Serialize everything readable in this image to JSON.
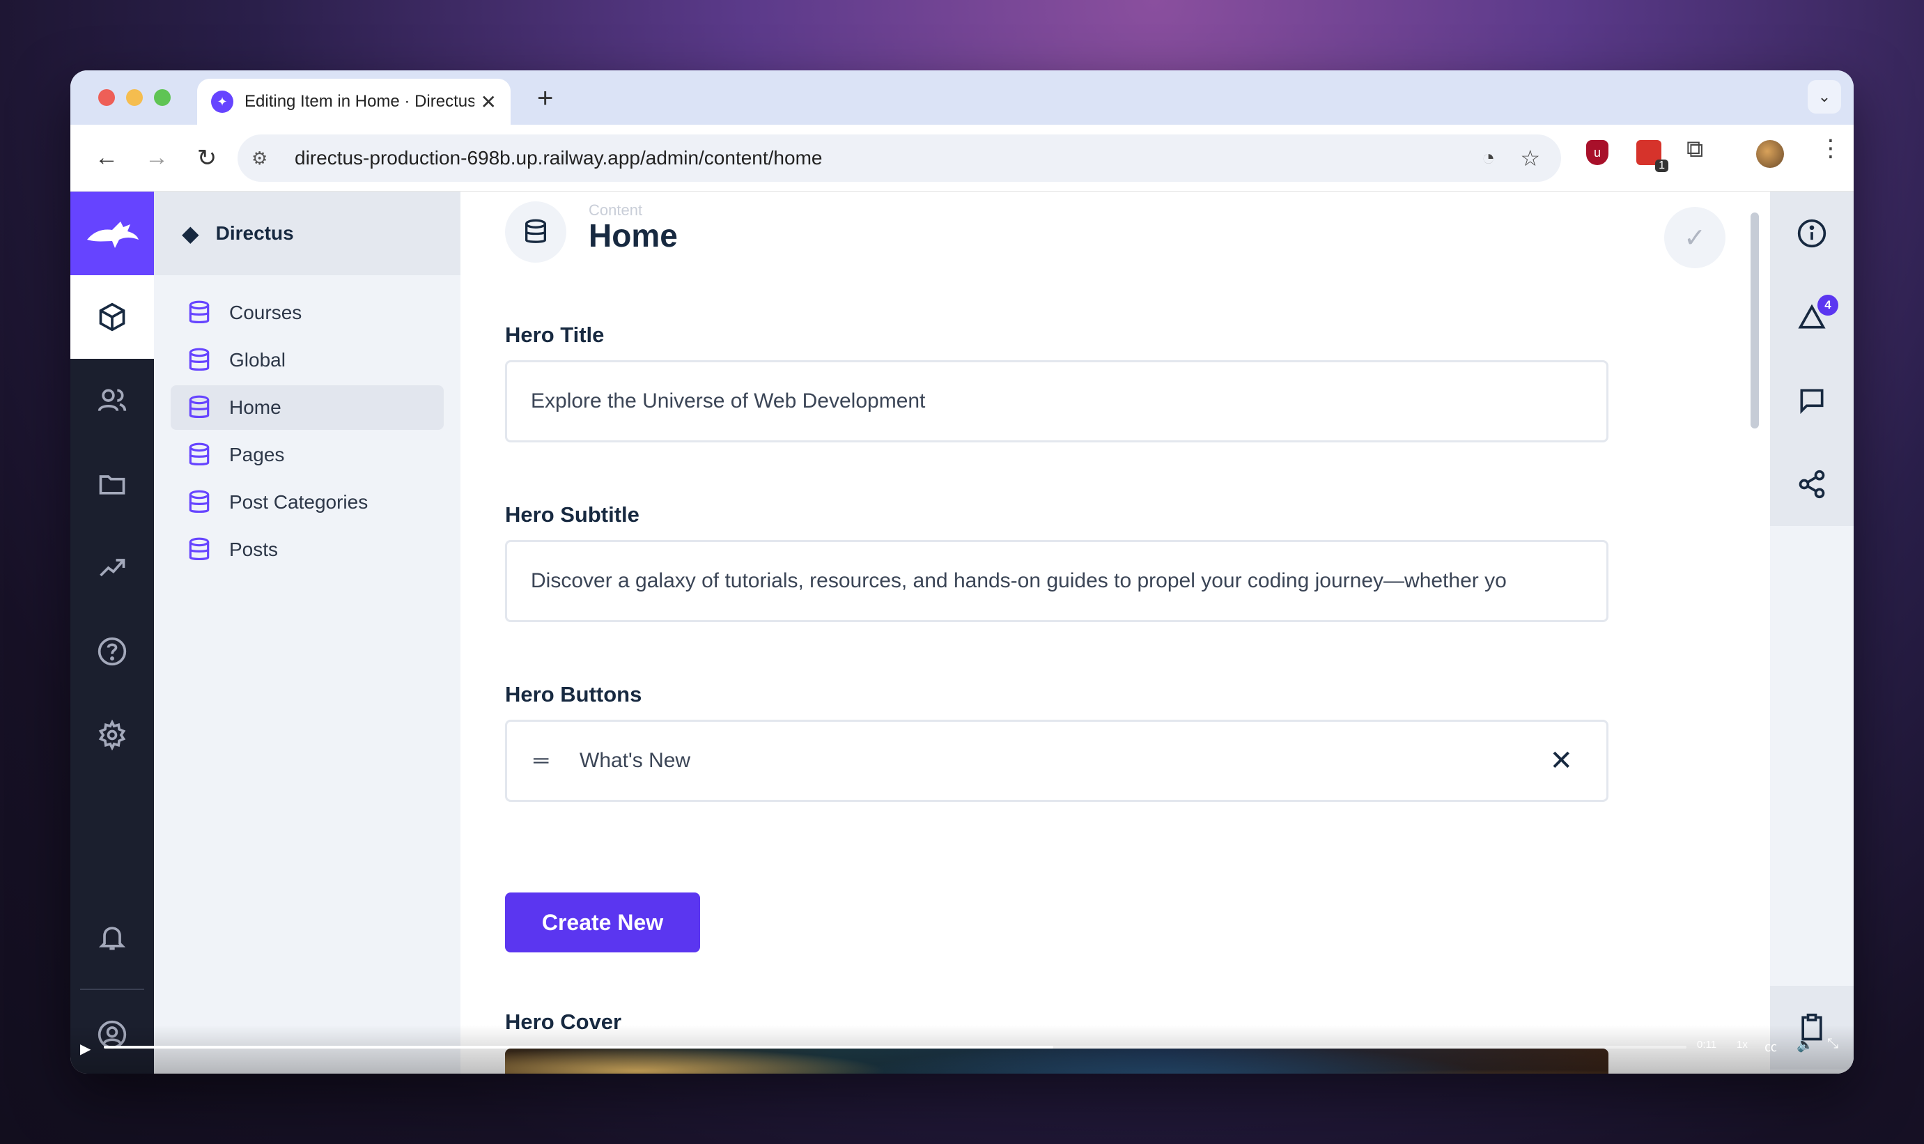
{
  "browser": {
    "tab_title": "Editing Item in Home · Directus",
    "new_tab_icon": "plus-icon",
    "url": "directus-production-698b.up.railway.app/admin/content/home",
    "extension_badge": "1"
  },
  "app": {
    "project_name": "Directus",
    "accent_color": "#6644ff",
    "collections": [
      {
        "label": "Courses",
        "active": false
      },
      {
        "label": "Global",
        "active": false
      },
      {
        "label": "Home",
        "active": true
      },
      {
        "label": "Pages",
        "active": false
      },
      {
        "label": "Post Categories",
        "active": false
      },
      {
        "label": "Posts",
        "active": false
      }
    ]
  },
  "header": {
    "breadcrumb": "Content",
    "title": "Home"
  },
  "form": {
    "hero_title_label": "Hero Title",
    "hero_title_value": "Explore the Universe of Web Development",
    "hero_subtitle_label": "Hero Subtitle",
    "hero_subtitle_value": "Discover a galaxy of tutorials, resources, and hands-on guides to propel your coding journey—whether yo",
    "hero_buttons_label": "Hero Buttons",
    "hero_buttons_items": [
      "What's New"
    ],
    "create_new_label": "Create New",
    "hero_cover_label": "Hero Cover"
  },
  "sidebar_right": {
    "activity_badge": "4"
  },
  "video": {
    "time": "0:11",
    "rate": "1x",
    "progress": 0.6
  }
}
